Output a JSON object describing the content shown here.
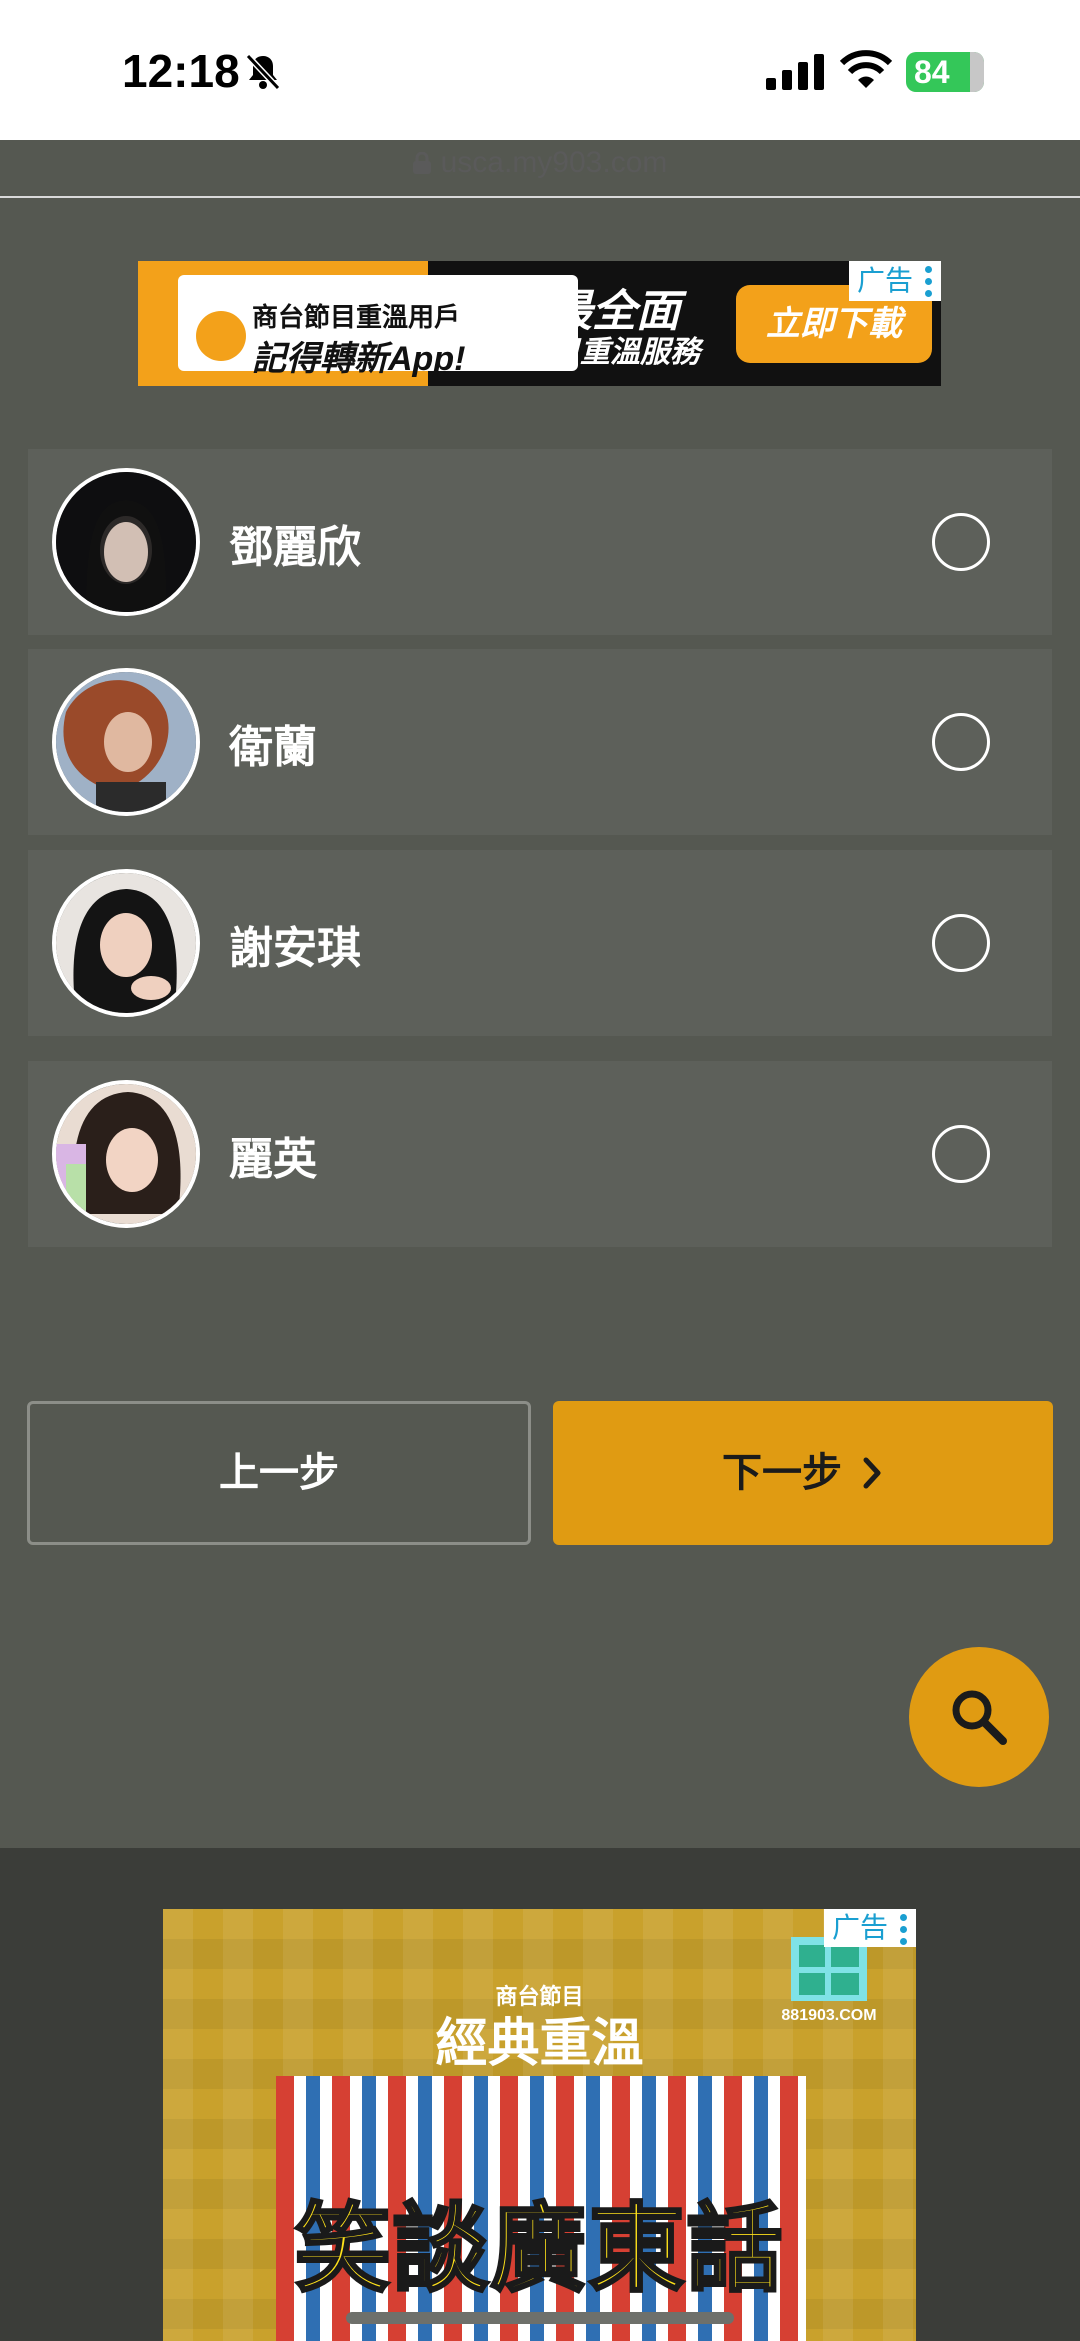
{
  "status_bar": {
    "time": "12:18",
    "battery": "84"
  },
  "browser": {
    "url": "usca.my903.com"
  },
  "ad_top": {
    "tag": "广告",
    "line1": "商台節目重溫用戶",
    "line2": "記得轉新App!",
    "headline": "使用最全面",
    "subline": "商台節目重溫服務",
    "cta": "立即下載"
  },
  "list": {
    "items": [
      {
        "name": "鄧麗欣",
        "selected": false
      },
      {
        "name": "衛蘭",
        "selected": false
      },
      {
        "name": "謝安琪",
        "selected": false
      },
      {
        "name": "麗英",
        "selected": false
      }
    ]
  },
  "buttons": {
    "prev": "上一步",
    "next": "下一步"
  },
  "ad_bottom": {
    "tag": "广告",
    "subtitle": "商台節目",
    "title": "經典重溫",
    "headline": "笑談廣東話",
    "brand": "881903.COM"
  },
  "colors": {
    "accent": "#e09b12",
    "background": "#555851",
    "card": "#5d605a"
  }
}
